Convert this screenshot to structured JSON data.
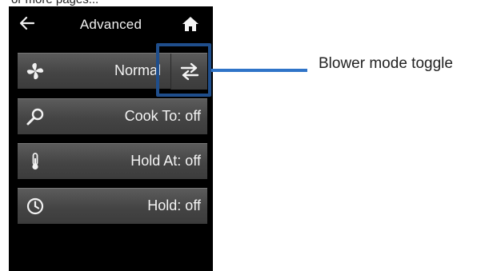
{
  "header": {
    "title": "Advanced",
    "back_icon": "arrow-left-icon",
    "home_icon": "home-icon"
  },
  "menu": {
    "items": [
      {
        "icon": "fan-icon",
        "label": "Normal",
        "has_toggle": true,
        "toggle_icon": "swap-arrows-icon"
      },
      {
        "icon": "probe-icon",
        "label": "Cook To: off"
      },
      {
        "icon": "thermometer-icon",
        "label": "Hold At: off"
      },
      {
        "icon": "clock-icon",
        "label": "Hold: off"
      }
    ]
  },
  "annotation": {
    "callout_text": "Blower mode toggle",
    "highlight_color": "#1f4e8c",
    "line_color": "#2f74c8"
  },
  "cropped_caption": "or more pages..."
}
